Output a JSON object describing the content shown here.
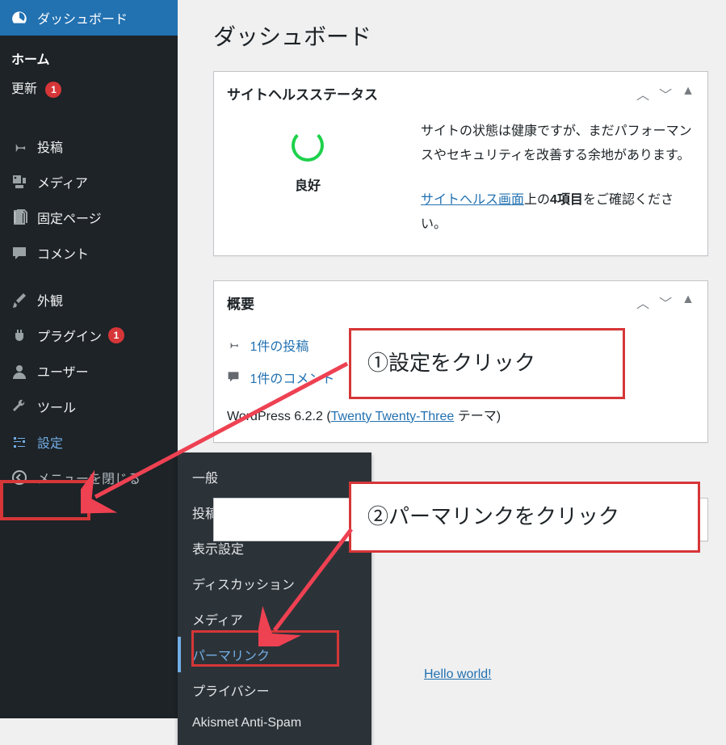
{
  "pageTitle": "ダッシュボード",
  "sidebar": {
    "dashboard": "ダッシュボード",
    "home": "ホーム",
    "updates": "更新",
    "updatesBadge": "1",
    "posts": "投稿",
    "media": "メディア",
    "pages": "固定ページ",
    "comments": "コメント",
    "appearance": "外観",
    "plugins": "プラグイン",
    "pluginsBadge": "1",
    "users": "ユーザー",
    "tools": "ツール",
    "settings": "設定",
    "collapse": "メニューを閉じる"
  },
  "flyout": {
    "general": "一般",
    "writing": "投稿設定",
    "reading": "表示設定",
    "discussion": "ディスカッション",
    "media": "メディア",
    "permalink": "パーマリンク",
    "privacy": "プライバシー",
    "akismet": "Akismet Anti-Spam"
  },
  "health": {
    "title": "サイトヘルスステータス",
    "status": "良好",
    "text1": "サイトの状態は健康ですが、まだパフォーマンスやセキュリティを改善する余地があります。",
    "link": "サイトヘルス画面",
    "text2a": "上の",
    "text2b": "4項目",
    "text2c": "をご確認ください。"
  },
  "overview": {
    "title": "概要",
    "posts": "1件の投稿",
    "comments": "1件のコメント",
    "version_pre": "WordPress 6.2.2 (",
    "theme": "Twenty Twenty-Three",
    "version_post": " テーマ)"
  },
  "callouts": {
    "c1": "①設定をクリック",
    "c2": "②パーマリンクをクリック"
  },
  "hello": "Hello world!"
}
